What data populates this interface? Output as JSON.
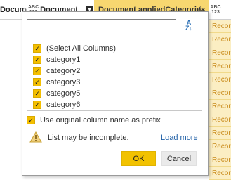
{
  "header": {
    "col1_label": "Document...",
    "col2_type": "ABC\n123",
    "col2_label": "Document...",
    "col3_label": "Document.appliedCategories",
    "col4_type": "ABC\n123"
  },
  "records": [
    "Recor",
    "Recor",
    "Recor",
    "Recor",
    "Recor",
    "Recor",
    "Recor",
    "Recor",
    "Recor",
    "Recor",
    "Recor",
    "Recor"
  ],
  "popup": {
    "search_value": "",
    "items": [
      {
        "label": "(Select All Columns)",
        "checked": true
      },
      {
        "label": "category1",
        "checked": true
      },
      {
        "label": "category2",
        "checked": true
      },
      {
        "label": "category3",
        "checked": true
      },
      {
        "label": "category5",
        "checked": true
      },
      {
        "label": "category6",
        "checked": true
      }
    ],
    "prefix_label": "Use original column name as prefix",
    "warning_text": "List may be incomplete.",
    "load_more": "Load more",
    "ok_label": "OK",
    "cancel_label": "Cancel"
  },
  "colors": {
    "accent": "#f2c200",
    "link": "#1f5fa6",
    "record_text": "#c98a1a"
  }
}
